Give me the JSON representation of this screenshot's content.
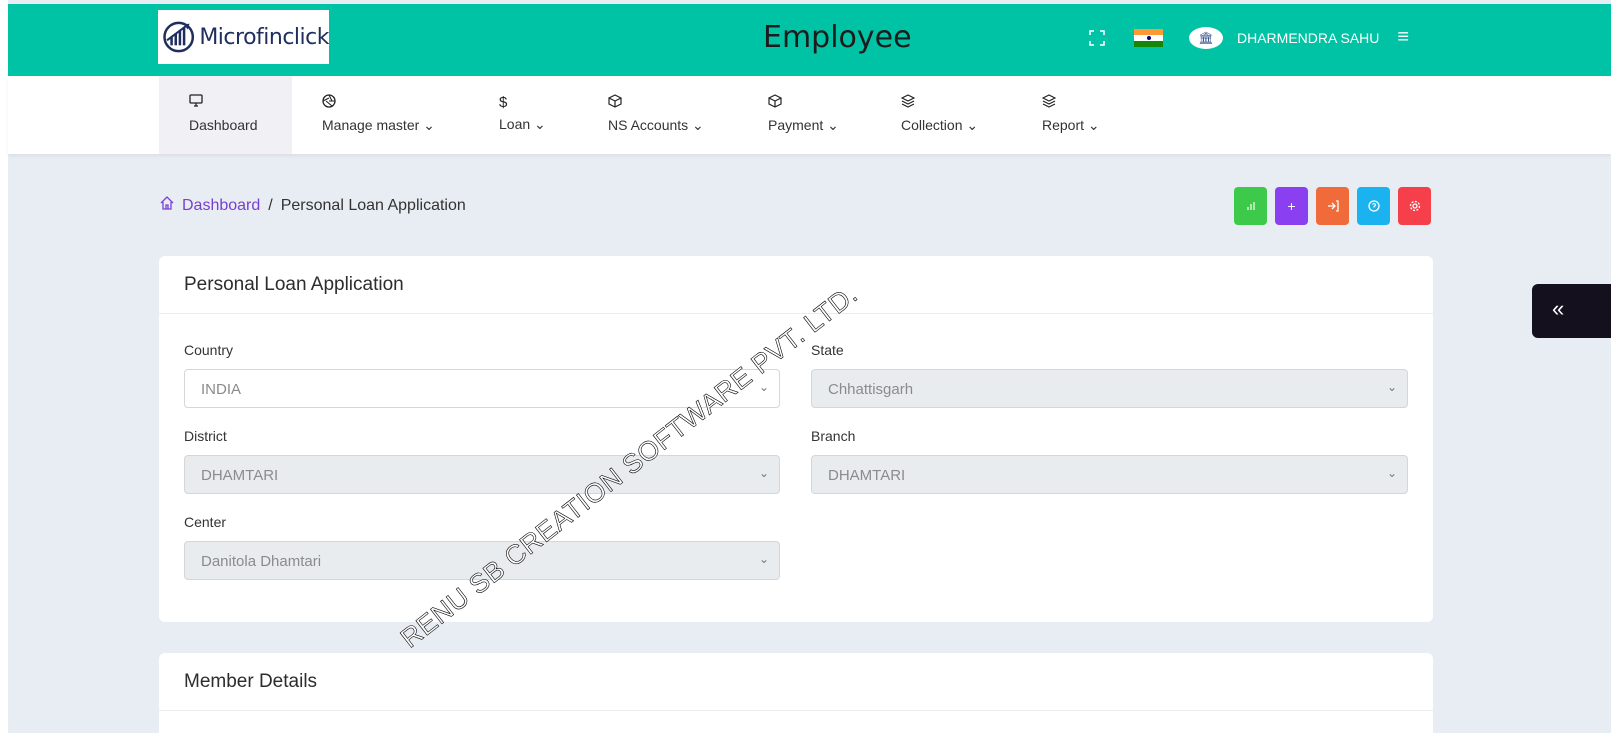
{
  "header": {
    "logo_text": "Microfinclick",
    "title": "Employee",
    "user_name": "DHARMENDRA SAHU"
  },
  "nav": {
    "items": [
      {
        "label": "Dashboard",
        "icon": "monitor-icon"
      },
      {
        "label": "Manage master ⌄",
        "icon": "aperture-icon"
      },
      {
        "label": "Loan ⌄",
        "icon": "dollar-icon"
      },
      {
        "label": "NS Accounts ⌄",
        "icon": "box-icon"
      },
      {
        "label": "Payment ⌄",
        "icon": "box-icon"
      },
      {
        "label": "Collection ⌄",
        "icon": "layers-icon"
      },
      {
        "label": "Report ⌄",
        "icon": "layers-icon"
      }
    ]
  },
  "breadcrumb": {
    "home": "Dashboard",
    "separator": "/",
    "current": "Personal Loan Application"
  },
  "quick_buttons": {
    "colors": [
      "#3dc94a",
      "#8a3ff0",
      "#f06a3a",
      "#1bb3ef",
      "#f53f4a"
    ],
    "icons": [
      "chart-icon",
      "plus-icon",
      "login-icon",
      "help-icon",
      "settings-icon"
    ]
  },
  "form_card": {
    "title": "Personal Loan Application",
    "country_label": "Country",
    "country_value": "INDIA",
    "state_label": "State",
    "state_value": "Chhattisgarh",
    "district_label": "District",
    "district_value": "DHAMTARI",
    "branch_label": "Branch",
    "branch_value": "DHAMTARI",
    "center_label": "Center",
    "center_value": "Danitola Dhamtari"
  },
  "member_card": {
    "title": "Member Details"
  },
  "watermark": "RENU SB CREATION SOFTWARE PVT. LTD.",
  "colors": {
    "topbar": "#00c3a5",
    "accent_link": "#7a3fcf",
    "background": "#e8edf3"
  }
}
